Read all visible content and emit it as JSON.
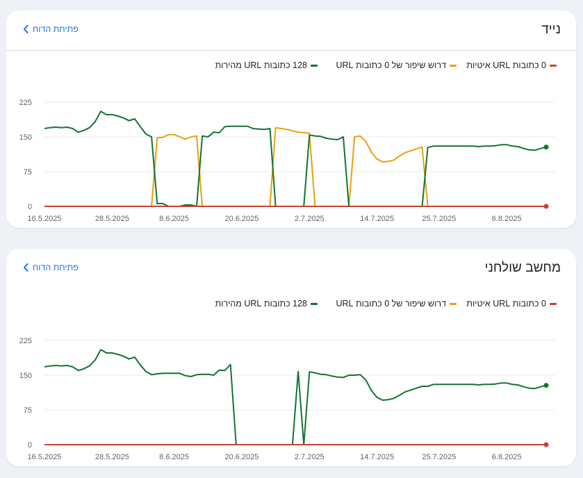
{
  "cards": [
    {
      "title": "נייד",
      "report_link": "פתיחת הדוח",
      "legend": [
        {
          "label": "0 כתובות URL איטיות",
          "color": "#c5432e"
        },
        {
          "label": "דרוש שיפור של 0 כתובות URL",
          "color": "#e8a00c"
        },
        {
          "label": "128 כתובות URL מהירות",
          "color": "#137333"
        }
      ]
    },
    {
      "title": "מחשב שולחני",
      "report_link": "פתיחת הדוח",
      "legend": [
        {
          "label": "0 כתובות URL איטיות",
          "color": "#c5432e"
        },
        {
          "label": "דרוש שיפור של 0 כתובות URL",
          "color": "#e8a00c"
        },
        {
          "label": "128 כתובות URL מהירות",
          "color": "#137333"
        }
      ]
    }
  ],
  "chart_data": [
    {
      "type": "line",
      "title": "נייד",
      "yticks": [
        0,
        75,
        150,
        225
      ],
      "ylim": [
        0,
        225
      ],
      "xlim": [
        0,
        89
      ],
      "xticks": [
        {
          "x": 0,
          "label": "16.5.2025"
        },
        {
          "x": 12,
          "label": "28.5.2025"
        },
        {
          "x": 23,
          "label": "8.6.2025"
        },
        {
          "x": 35,
          "label": "20.6.2025"
        },
        {
          "x": 47,
          "label": "2.7.2025"
        },
        {
          "x": 59,
          "label": "14.7.2025"
        },
        {
          "x": 70,
          "label": "25.7.2025"
        },
        {
          "x": 82,
          "label": "6.8.2025"
        }
      ],
      "grid": true,
      "series": [
        {
          "name": "128 כתובות URL מהירות",
          "color": "#137333",
          "end_marker": true,
          "points": [
            [
              0,
              168
            ],
            [
              1,
              170
            ],
            [
              2,
              171
            ],
            [
              3,
              170
            ],
            [
              4,
              171
            ],
            [
              5,
              168
            ],
            [
              6,
              160
            ],
            [
              7,
              164
            ],
            [
              8,
              170
            ],
            [
              9,
              183
            ],
            [
              10,
              205
            ],
            [
              11,
              198
            ],
            [
              12,
              198
            ],
            [
              13,
              195
            ],
            [
              14,
              191
            ],
            [
              15,
              185
            ],
            [
              16,
              189
            ],
            [
              17,
              172
            ],
            [
              18,
              156
            ],
            [
              19,
              150
            ],
            [
              20,
              6
            ],
            [
              21,
              6
            ],
            [
              22,
              0
            ],
            [
              23,
              0
            ],
            [
              24,
              0
            ],
            [
              25,
              3
            ],
            [
              26,
              3
            ],
            [
              27,
              0
            ],
            [
              28,
              152
            ],
            [
              29,
              150
            ],
            [
              30,
              160
            ],
            [
              31,
              159
            ],
            [
              32,
              172
            ],
            [
              33,
              173
            ],
            [
              34,
              173
            ],
            [
              35,
              173
            ],
            [
              36,
              173
            ],
            [
              37,
              168
            ],
            [
              38,
              167
            ],
            [
              39,
              166
            ],
            [
              40,
              168
            ],
            [
              41,
              0
            ],
            [
              42,
              0
            ],
            [
              43,
              0
            ],
            [
              44,
              0
            ],
            [
              45,
              0
            ],
            [
              46,
              0
            ],
            [
              47,
              154
            ],
            [
              48,
              152
            ],
            [
              49,
              151
            ],
            [
              50,
              147
            ],
            [
              51,
              145
            ],
            [
              52,
              144
            ],
            [
              53,
              150
            ],
            [
              54,
              0
            ],
            [
              55,
              0
            ],
            [
              56,
              0
            ],
            [
              57,
              0
            ],
            [
              58,
              0
            ],
            [
              59,
              0
            ],
            [
              60,
              0
            ],
            [
              61,
              0
            ],
            [
              62,
              0
            ],
            [
              63,
              0
            ],
            [
              64,
              0
            ],
            [
              65,
              0
            ],
            [
              66,
              0
            ],
            [
              67,
              0
            ],
            [
              68,
              127
            ],
            [
              69,
              130
            ],
            [
              70,
              130
            ],
            [
              71,
              130
            ],
            [
              72,
              130
            ],
            [
              73,
              130
            ],
            [
              74,
              130
            ],
            [
              75,
              130
            ],
            [
              76,
              130
            ],
            [
              77,
              129
            ],
            [
              78,
              130
            ],
            [
              79,
              130
            ],
            [
              80,
              131
            ],
            [
              81,
              133
            ],
            [
              82,
              133
            ],
            [
              83,
              130
            ],
            [
              84,
              129
            ],
            [
              85,
              125
            ],
            [
              86,
              122
            ],
            [
              87,
              121
            ],
            [
              88,
              125
            ],
            [
              89,
              128
            ]
          ]
        },
        {
          "name": "דרוש שיפור של 0 כתובות URL",
          "color": "#e8a00c",
          "end_marker": false,
          "points": [
            [
              0,
              0
            ],
            [
              19,
              0
            ],
            [
              20,
              148
            ],
            [
              21,
              149
            ],
            [
              22,
              155
            ],
            [
              23,
              155
            ],
            [
              24,
              150
            ],
            [
              25,
              145
            ],
            [
              26,
              150
            ],
            [
              27,
              152
            ],
            [
              28,
              0
            ],
            [
              40,
              0
            ],
            [
              41,
              170
            ],
            [
              42,
              168
            ],
            [
              43,
              166
            ],
            [
              44,
              163
            ],
            [
              45,
              160
            ],
            [
              46,
              159
            ],
            [
              47,
              158
            ],
            [
              48,
              0
            ],
            [
              54,
              0
            ],
            [
              55,
              150
            ],
            [
              56,
              152
            ],
            [
              57,
              140
            ],
            [
              58,
              117
            ],
            [
              59,
              102
            ],
            [
              60,
              96
            ],
            [
              61,
              97
            ],
            [
              62,
              100
            ],
            [
              63,
              109
            ],
            [
              64,
              116
            ],
            [
              65,
              120
            ],
            [
              66,
              124
            ],
            [
              67,
              128
            ],
            [
              68,
              0
            ],
            [
              89,
              0
            ]
          ]
        },
        {
          "name": "0 כתובות URL איטיות",
          "color": "#c5432e",
          "end_marker": true,
          "points": [
            [
              0,
              0
            ],
            [
              89,
              0
            ]
          ]
        }
      ]
    },
    {
      "type": "line",
      "title": "מחשב שולחני",
      "yticks": [
        0,
        75,
        150,
        225
      ],
      "ylim": [
        0,
        225
      ],
      "xlim": [
        0,
        89
      ],
      "xticks": [
        {
          "x": 0,
          "label": "16.5.2025"
        },
        {
          "x": 12,
          "label": "28.5.2025"
        },
        {
          "x": 23,
          "label": "8.6.2025"
        },
        {
          "x": 35,
          "label": "20.6.2025"
        },
        {
          "x": 47,
          "label": "2.7.2025"
        },
        {
          "x": 59,
          "label": "14.7.2025"
        },
        {
          "x": 70,
          "label": "25.7.2025"
        },
        {
          "x": 82,
          "label": "6.8.2025"
        }
      ],
      "grid": true,
      "series": [
        {
          "name": "128 כתובות URL מהירות",
          "color": "#137333",
          "end_marker": true,
          "points": [
            [
              0,
              168
            ],
            [
              1,
              170
            ],
            [
              2,
              171
            ],
            [
              3,
              170
            ],
            [
              4,
              171
            ],
            [
              5,
              168
            ],
            [
              6,
              160
            ],
            [
              7,
              164
            ],
            [
              8,
              170
            ],
            [
              9,
              183
            ],
            [
              10,
              205
            ],
            [
              11,
              198
            ],
            [
              12,
              198
            ],
            [
              13,
              195
            ],
            [
              14,
              191
            ],
            [
              15,
              185
            ],
            [
              16,
              189
            ],
            [
              17,
              172
            ],
            [
              18,
              158
            ],
            [
              19,
              151
            ],
            [
              20,
              153
            ],
            [
              21,
              154
            ],
            [
              22,
              154
            ],
            [
              23,
              154
            ],
            [
              24,
              154
            ],
            [
              25,
              149
            ],
            [
              26,
              147
            ],
            [
              27,
              151
            ],
            [
              28,
              152
            ],
            [
              29,
              152
            ],
            [
              30,
              150
            ],
            [
              31,
              161
            ],
            [
              32,
              160
            ],
            [
              33,
              173
            ],
            [
              34,
              0
            ],
            [
              35,
              0
            ],
            [
              36,
              0
            ],
            [
              37,
              0
            ],
            [
              38,
              0
            ],
            [
              39,
              0
            ],
            [
              40,
              0
            ],
            [
              41,
              0
            ],
            [
              42,
              0
            ],
            [
              43,
              0
            ],
            [
              44,
              0
            ],
            [
              45,
              158
            ],
            [
              46,
              0
            ],
            [
              47,
              157
            ],
            [
              48,
              155
            ],
            [
              49,
              152
            ],
            [
              50,
              151
            ],
            [
              51,
              148
            ],
            [
              52,
              146
            ],
            [
              53,
              145
            ],
            [
              54,
              150
            ],
            [
              55,
              150
            ],
            [
              56,
              151
            ],
            [
              57,
              140
            ],
            [
              58,
              117
            ],
            [
              59,
              102
            ],
            [
              60,
              96
            ],
            [
              61,
              97
            ],
            [
              62,
              100
            ],
            [
              63,
              107
            ],
            [
              64,
              114
            ],
            [
              65,
              118
            ],
            [
              66,
              122
            ],
            [
              67,
              126
            ],
            [
              68,
              126
            ],
            [
              69,
              130
            ],
            [
              70,
              130
            ],
            [
              71,
              130
            ],
            [
              72,
              130
            ],
            [
              73,
              130
            ],
            [
              74,
              130
            ],
            [
              75,
              130
            ],
            [
              76,
              130
            ],
            [
              77,
              129
            ],
            [
              78,
              130
            ],
            [
              79,
              130
            ],
            [
              80,
              131
            ],
            [
              81,
              133
            ],
            [
              82,
              133
            ],
            [
              83,
              130
            ],
            [
              84,
              129
            ],
            [
              85,
              125
            ],
            [
              86,
              122
            ],
            [
              87,
              121
            ],
            [
              88,
              125
            ],
            [
              89,
              128
            ]
          ]
        },
        {
          "name": "דרוש שיפור של 0 כתובות URL",
          "color": "#e8a00c",
          "end_marker": false,
          "points": [
            [
              0,
              0
            ],
            [
              89,
              0
            ]
          ]
        },
        {
          "name": "0 כתובות URL איטיות",
          "color": "#c5432e",
          "end_marker": true,
          "points": [
            [
              0,
              0
            ],
            [
              89,
              0
            ]
          ]
        }
      ]
    }
  ]
}
